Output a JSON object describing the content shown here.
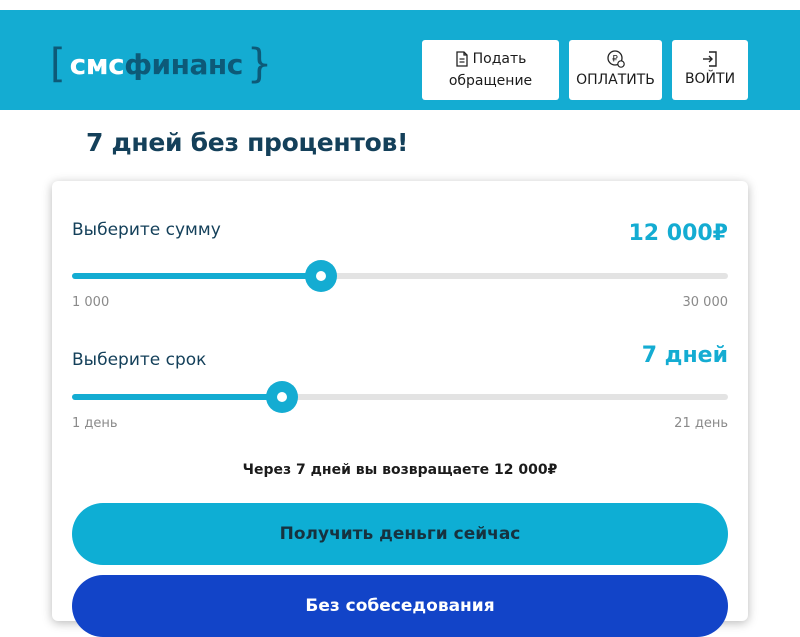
{
  "header": {
    "logo": {
      "left_bracket": "[",
      "part1": "смс",
      "part2": "финанс",
      "right_bracket": "}"
    },
    "appeal_button": {
      "line1": "Подать",
      "line2": "обращение",
      "icon": "document-icon"
    },
    "pay_button": {
      "label": "ОПЛАТИТЬ",
      "icon": "ruble-coin-icon"
    },
    "login_button": {
      "label": "ВОЙТИ",
      "icon": "login-icon"
    },
    "color": "#14acd2"
  },
  "title": "7 дней без процентов!",
  "calculator": {
    "amount": {
      "label": "Выберите сумму",
      "value": "12 000₽",
      "min": "1 000",
      "max": "30 000",
      "fraction": 0.38
    },
    "term": {
      "label": "Выберите срок",
      "value": "7 дней",
      "min": "1 день",
      "max": "21 день",
      "fraction": 0.32
    },
    "summary": "Через 7 дней вы возвращаете 12 000₽"
  },
  "cta": {
    "primary": "Получить деньги сейчас",
    "secondary": "Без собеседования"
  },
  "colors": {
    "accent": "#14acd2",
    "dark": "#14405a",
    "secondary_cta": "#1244c8"
  }
}
